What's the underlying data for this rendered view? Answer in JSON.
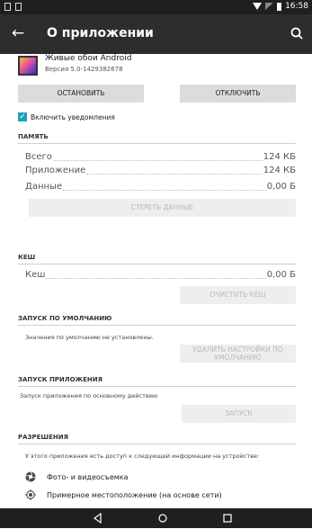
{
  "status_bar": {
    "time": "16:58"
  },
  "app_bar": {
    "title": "О приложении",
    "back_icon": "arrow-back-icon",
    "search_icon": "search-icon"
  },
  "app": {
    "name": "Живые обои Android",
    "version": "Версия 5.0-1429382678"
  },
  "actions": {
    "stop": "ОСТАНОВИТЬ",
    "disable": "ОТКЛЮЧИТЬ"
  },
  "notifications": {
    "label": "Включить уведомления",
    "checked": true
  },
  "storage": {
    "header": "ПАМЯТЬ",
    "rows": [
      {
        "label": "Всего",
        "value": "124 КБ"
      },
      {
        "label": "Приложение",
        "value": "124 КБ"
      },
      {
        "label": "Данные",
        "value": "0,00 Б"
      }
    ],
    "clear_data": "СТЕРЕТЬ ДАННЫЕ"
  },
  "cache": {
    "header": "КЕШ",
    "row": {
      "label": "Кеш",
      "value": "0,00 Б"
    },
    "clear_cache": "ОЧИСТИТЬ КЕШ"
  },
  "launch_default": {
    "header": "ЗАПУСК ПО УМОЛЧАНИЮ",
    "note": "Значения по умолчанию не установлены.",
    "clear_defaults_line1": "УДАЛИТЬ НАСТРОЙКИ ПО",
    "clear_defaults_line2": "УМОЛЧАНИЮ"
  },
  "app_launch": {
    "header": "ЗАПУСК ПРИЛОЖЕНИЯ",
    "note": "Запуск приложения по основному действию",
    "launch": "ЗАПУСК"
  },
  "permissions": {
    "header": "РАЗРЕШЕНИЯ",
    "note": "У этого приложения есть доступ к следующей информации на устройстве:",
    "items": [
      {
        "label": "Фото- и видеосъемка",
        "icon": "camera-icon"
      },
      {
        "label": "Примерное местоположение (на основе сети)",
        "icon": "location-icon"
      }
    ]
  },
  "nav": {
    "back": "nav-back-icon",
    "home": "nav-home-icon",
    "recents": "nav-recents-icon"
  },
  "colors": {
    "accent": "#1aa3b8",
    "app_bar": "#2d2d2d",
    "button": "#dcdcdc"
  }
}
